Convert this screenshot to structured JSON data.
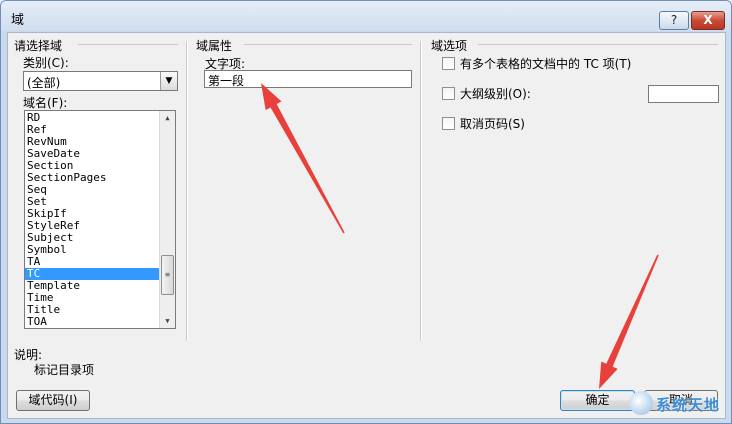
{
  "window": {
    "title": "域",
    "help_label": "?",
    "close_label": "X"
  },
  "left": {
    "group_title": "请选择域",
    "category_label": "类别(C):",
    "category_value": "(全部)",
    "field_name_label": "域名(F):",
    "field_names": [
      "RD",
      "Ref",
      "RevNum",
      "SaveDate",
      "Section",
      "SectionPages",
      "Seq",
      "Set",
      "SkipIf",
      "StyleRef",
      "Subject",
      "Symbol",
      "TA",
      "TC",
      "Template",
      "Time",
      "Title",
      "TOA"
    ],
    "selected_index": 13
  },
  "middle": {
    "group_title": "域属性",
    "text_entry_label": "文字项:",
    "text_entry_value": "第一段"
  },
  "right": {
    "group_title": "域选项",
    "options": [
      {
        "label": "有多个表格的文档中的 TC 项(T)",
        "checked": false
      },
      {
        "label": "大纲级别(O):",
        "checked": false
      },
      {
        "label": "取消页码(S)",
        "checked": false
      }
    ]
  },
  "description": {
    "label": "说明:",
    "text": "标记目录项"
  },
  "buttons": {
    "field_codes": "域代码(I)",
    "ok": "确定",
    "cancel": "取消"
  },
  "watermark": {
    "text": "系统天地"
  },
  "colors": {
    "selection": "#3399ff",
    "arrow": "#e8403a"
  }
}
